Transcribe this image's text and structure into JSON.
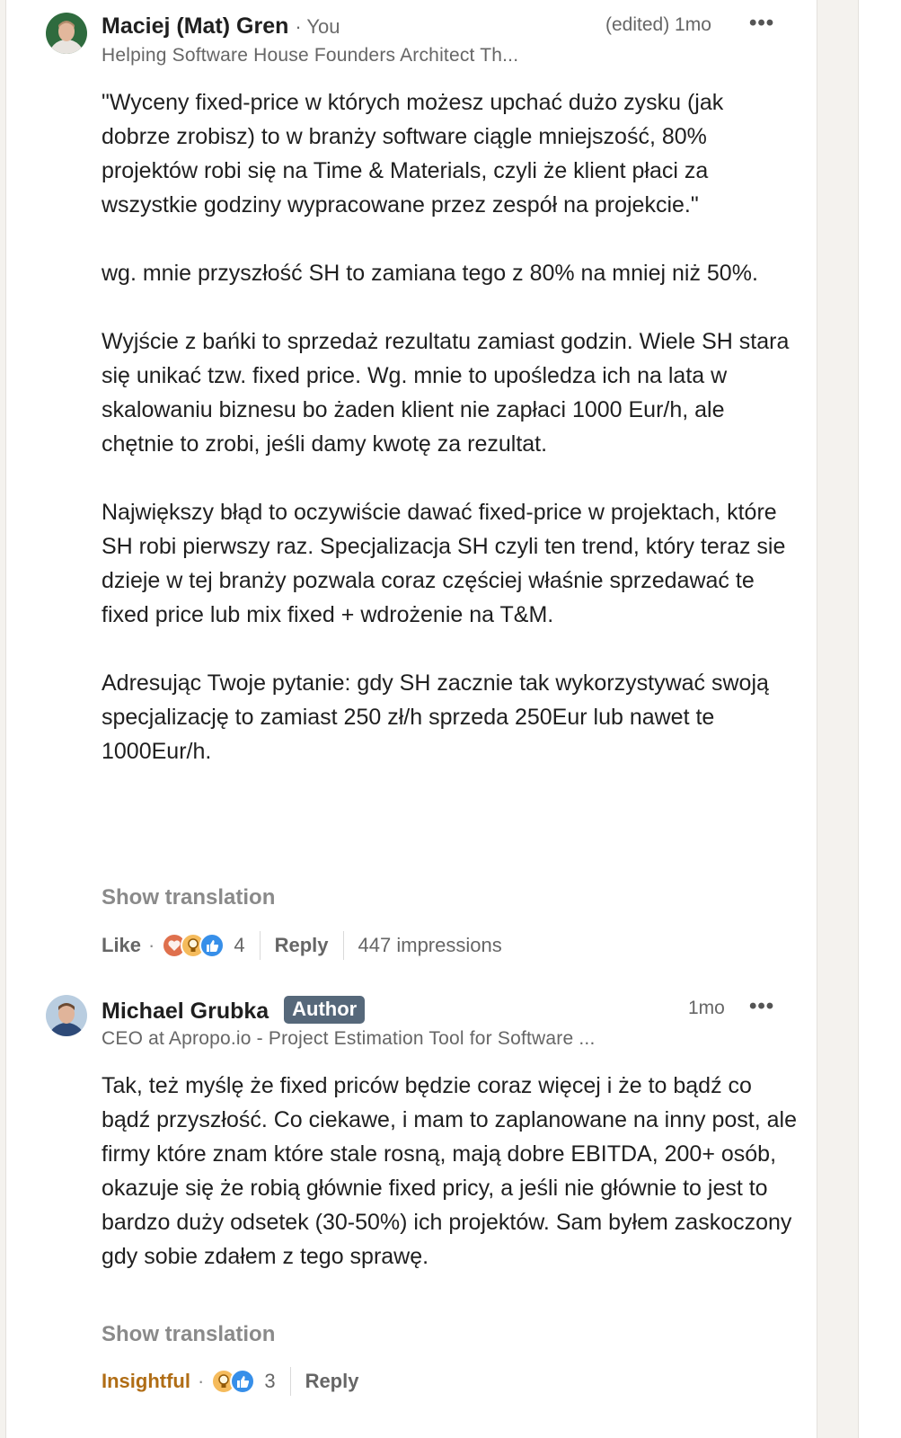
{
  "comments": [
    {
      "author": "Maciej (Mat) Gren",
      "you_label": "You",
      "headline": "Helping Software House Founders Architect Th...",
      "edited": "(edited) 1mo",
      "paragraphs": [
        "\"Wyceny fixed-price w których możesz upchać dużo zysku (jak dobrze zrobisz) to w branży software ciągle mniejszość, 80% projektów robi się na Time & Materials, czyli że klient płaci za wszystkie godziny wypracowane przez zespół na projekcie.\"",
        "wg. mnie przyszłość SH to zamiana tego z 80% na mniej niż 50%.",
        "Wyjście z bańki to sprzedaż rezultatu zamiast godzin. Wiele SH stara się unikać tzw. fixed price. Wg. mnie to upośledza ich na lata w skalowaniu biznesu bo żaden klient nie zapłaci 1000 Eur/h, ale chętnie to zrobi, jeśli damy kwotę za rezultat.",
        "Największy błąd to oczywiście dawać fixed-price w projektach, które SH robi pierwszy raz. Specjalizacja SH czyli ten trend, który teraz sie dzieje w tej branży pozwala coraz częściej właśnie sprzedawać te fixed price lub mix fixed + wdrożenie na T&M.",
        "Adresując Twoje pytanie: gdy SH zacznie tak wykorzystywać swoją specjalizację to zamiast 250 zł/h sprzeda 250Eur lub nawet te 1000Eur/h."
      ],
      "show_translation": "Show translation",
      "like_label": "Like",
      "reaction_icons": [
        "heart-icon",
        "lightbulb-icon",
        "thumbs-up-icon"
      ],
      "reaction_count": "4",
      "reply_label": "Reply",
      "impressions": "447 impressions"
    },
    {
      "author": "Michael Grubka",
      "badge": "Author",
      "headline": "CEO at Apropo.io - Project Estimation Tool for Software ...",
      "time": "1mo",
      "paragraphs": [
        "Tak, też myślę że fixed priców będzie coraz więcej i że to bądź co bądź przyszłość. Co ciekawe, i mam to zaplanowane na inny post, ale firmy które znam które stale rosną, mają dobre EBITDA, 200+ osób, okazuje się że robią głównie fixed pricy, a jeśli nie głównie to jest to bardzo duży odsetek (30-50%) ich projektów. Sam byłem zaskoczony gdy sobie zdałem z tego sprawę."
      ],
      "show_translation": "Show translation",
      "reaction_label": "Insightful",
      "reaction_icons": [
        "lightbulb-icon",
        "thumbs-up-icon"
      ],
      "reaction_count": "3",
      "reply_label": "Reply"
    }
  ],
  "colors": {
    "like_blue": "#378fe9",
    "heart_red": "#df704d",
    "insight_yellow": "#f5bb5c",
    "insightful_text": "#b06d15",
    "badge_bg": "#56687a"
  }
}
